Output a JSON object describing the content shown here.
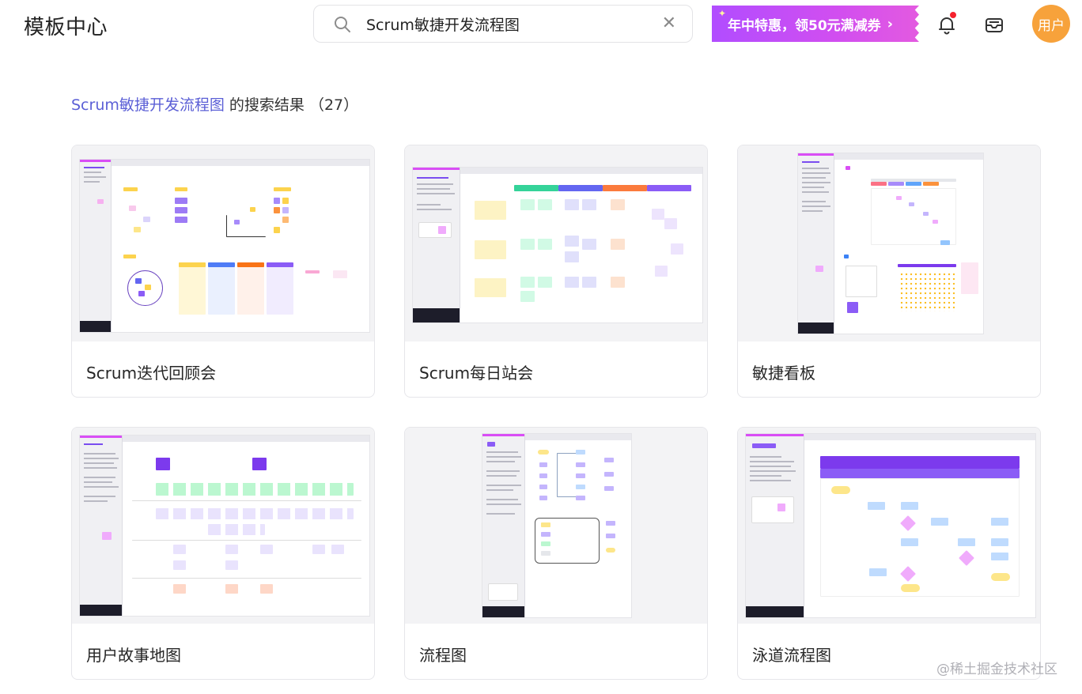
{
  "header": {
    "title": "模板中心",
    "search": {
      "value": "Scrum敏捷开发流程图",
      "placeholder": ""
    },
    "promo": {
      "label": "年中特惠，领50元满减券"
    },
    "avatar_label": "用户"
  },
  "results": {
    "query": "Scrum敏捷开发流程图",
    "suffix": " 的搜索结果 （27）"
  },
  "templates": [
    {
      "title": "Scrum迭代回顾会"
    },
    {
      "title": "Scrum每日站会"
    },
    {
      "title": "敏捷看板"
    },
    {
      "title": "用户故事地图"
    },
    {
      "title": "流程图"
    },
    {
      "title": "泳道流程图"
    }
  ],
  "watermark": "@稀土掘金技术社区",
  "colors": {
    "accent": "#5b5fd6",
    "promo": "#c14ef5",
    "avatar": "#f7a23b",
    "notification_dot": "#f5222d"
  },
  "icons": [
    "search-icon",
    "close-icon",
    "bell-icon",
    "inbox-icon",
    "chevron-right-icon"
  ]
}
